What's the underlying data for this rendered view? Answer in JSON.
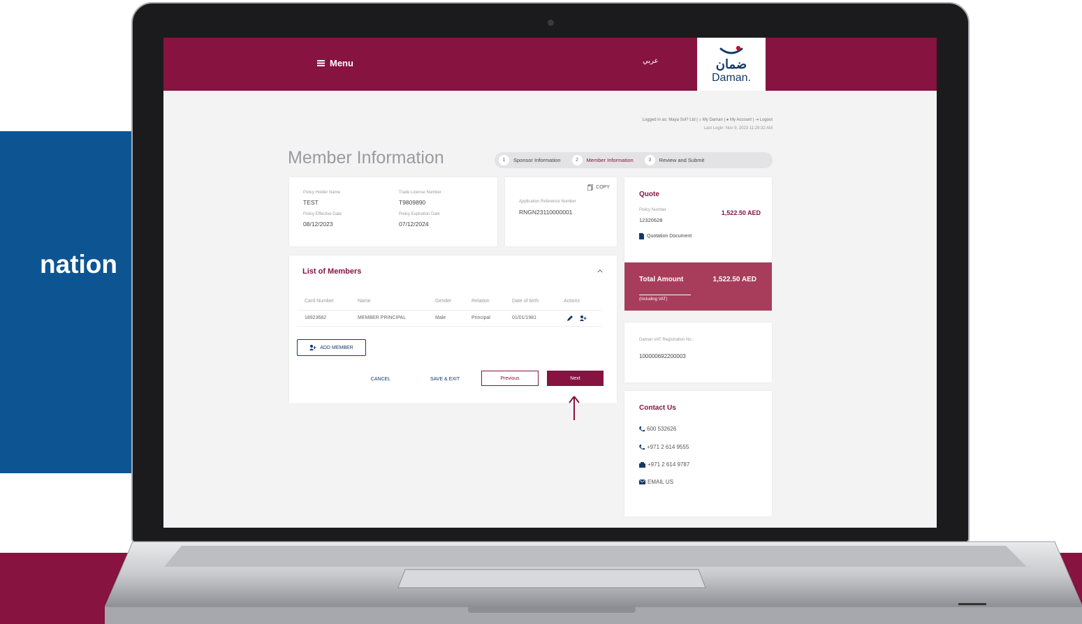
{
  "left_panel": {
    "label": "nation"
  },
  "topbar": {
    "menu_label": "Menu",
    "language_label": "عربي",
    "logo_arabic": "ضمان",
    "logo_english": "Daman."
  },
  "user_bar": {
    "logged_in_as": "Logged in as: Maya Sol? Ltd",
    "my_daman": "My Daman",
    "my_account": "My Account",
    "logout": "Logout",
    "last_login": "Last Login: Nov 9, 2023 11:29:32 AM"
  },
  "page_title": "Member Information",
  "steps": [
    {
      "number": "1",
      "label": "Sponsor Information"
    },
    {
      "number": "2",
      "label": "Member Information"
    },
    {
      "number": "3",
      "label": "Review and Submit"
    }
  ],
  "policy": {
    "holder_name_label": "Policy Holder Name",
    "holder_name": "TEST",
    "trade_license_label": "Trade License Number",
    "trade_license": "T9809890",
    "effective_label": "Policy Effective Date",
    "effective": "08/12/2023",
    "expiration_label": "Policy Expiration Date",
    "expiration": "07/12/2024"
  },
  "application": {
    "copy_label": "COPY",
    "ref_label": "Application Reference Number",
    "ref": "RNGN23110000001"
  },
  "quote": {
    "title": "Quote",
    "policy_number_label": "Policy Number",
    "policy_number": "12320628",
    "amount": "1,522.50 AED",
    "doc_label": "Quotation Document"
  },
  "total": {
    "label": "Total Amount",
    "amount": "1,522.50 AED",
    "vat_note": "(Including VAT)"
  },
  "vat": {
    "label": "Daman VAT Registration No.:",
    "number": "100000692200003"
  },
  "contact": {
    "title": "Contact Us",
    "phone1": "600 532626",
    "phone2": "+971 2 614 9555",
    "fax": "+971 2 614 9787",
    "email": "EMAIL US"
  },
  "members": {
    "title": "List of Members",
    "columns": [
      "Card Number",
      "Name",
      "Gender",
      "Relation",
      "Date of birth",
      "Actions"
    ],
    "rows": [
      {
        "card": "18923682",
        "name": "MEMBER PRINCIPAL",
        "gender": "Male",
        "relation": "Principal",
        "dob": "01/01/1981"
      }
    ],
    "add_member_label": "ADD MEMBER"
  },
  "actions": {
    "cancel": "CANCEL",
    "save_exit": "SAVE & EXIT",
    "previous": "Previous",
    "next": "Next"
  },
  "colors": {
    "brand_maroon": "#861340",
    "total_box": "#a83c5b",
    "side_blue": "#0c5592",
    "logo_navy": "#13396b"
  }
}
